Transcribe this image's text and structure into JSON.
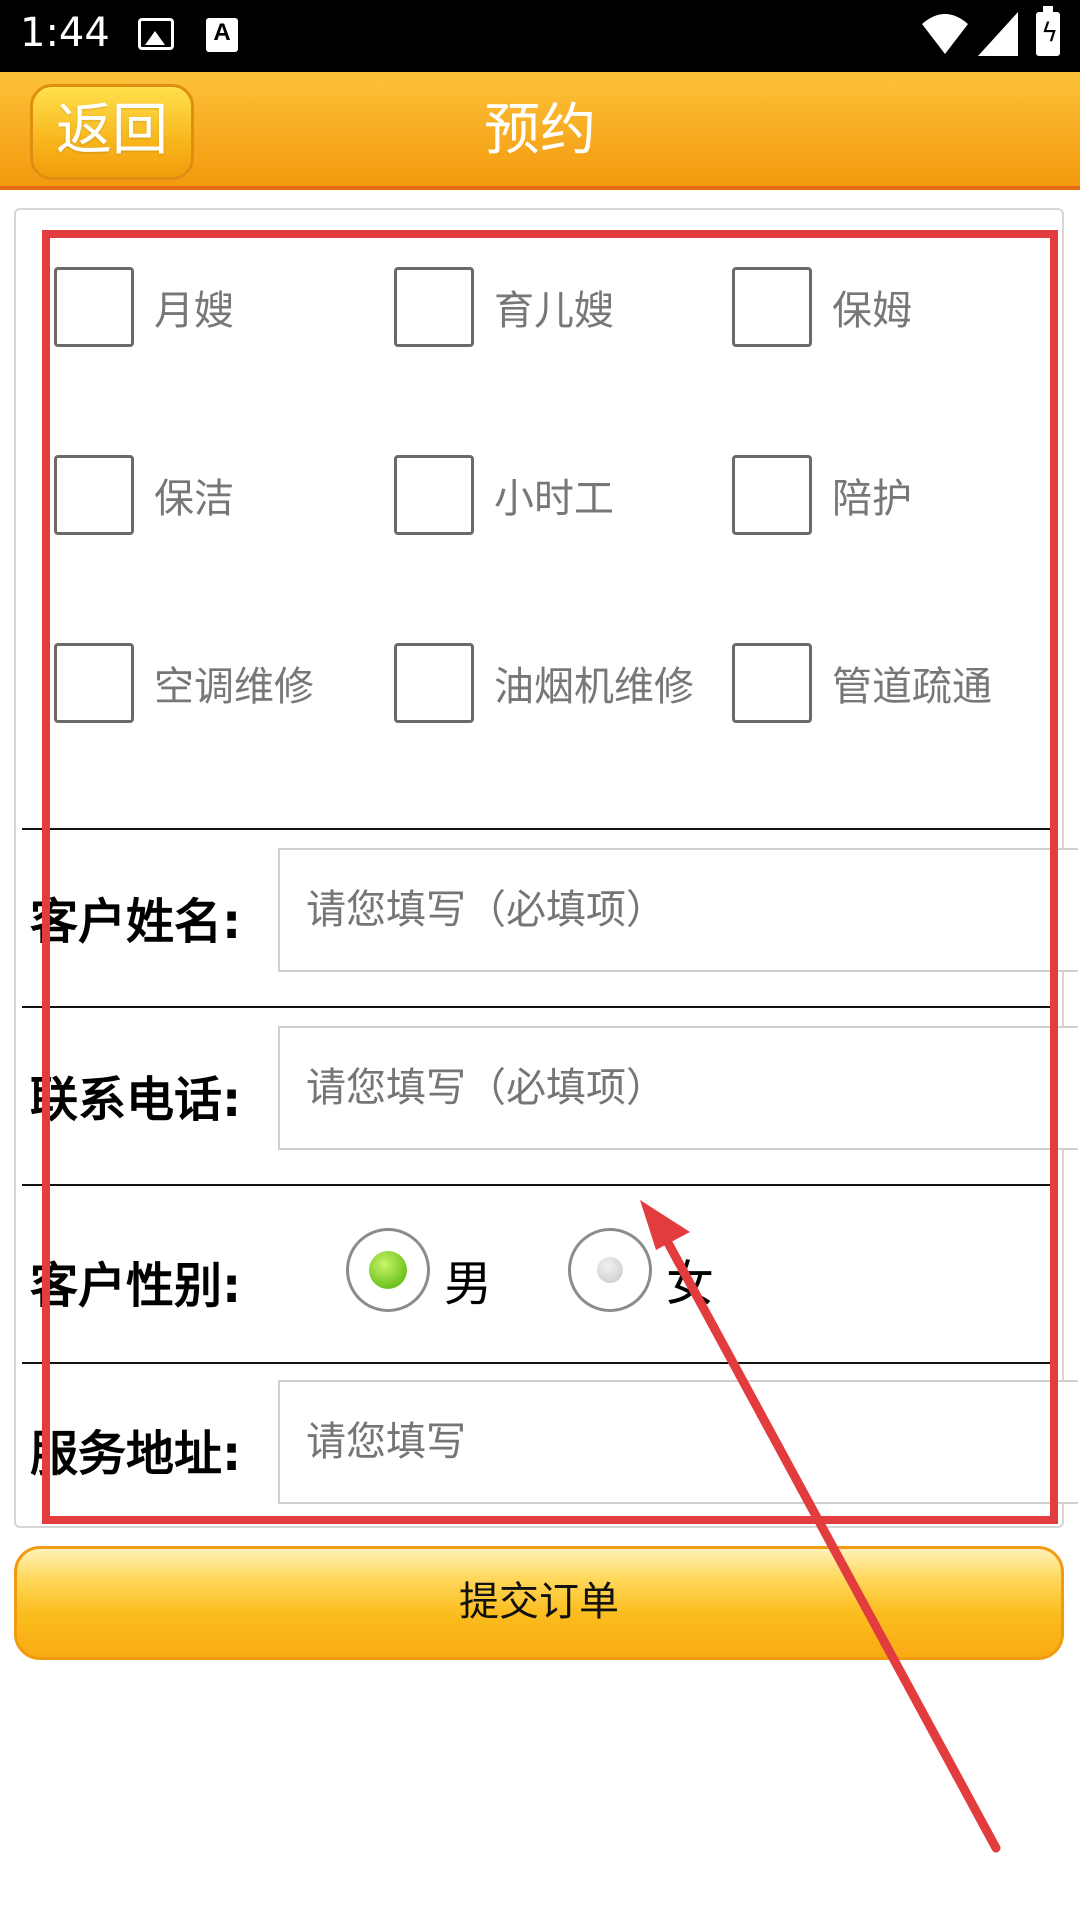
{
  "status_bar": {
    "time": "1:44",
    "icons": [
      "image-icon",
      "a11y-a-icon",
      "wifi-icon",
      "signal-icon",
      "battery-icon"
    ]
  },
  "header": {
    "back_label": "返回",
    "title": "预约"
  },
  "services": [
    {
      "label": "月嫂",
      "checked": false
    },
    {
      "label": "育儿嫂",
      "checked": false
    },
    {
      "label": "保姆",
      "checked": false
    },
    {
      "label": "保洁",
      "checked": false
    },
    {
      "label": "小时工",
      "checked": false
    },
    {
      "label": "陪护",
      "checked": false
    },
    {
      "label": "空调维修",
      "checked": false
    },
    {
      "label": "油烟机维修",
      "checked": false
    },
    {
      "label": "管道疏通",
      "checked": false
    }
  ],
  "form": {
    "name_label": "客户姓名:",
    "name_placeholder": "请您填写（必填项）",
    "phone_label": "联系电话:",
    "phone_placeholder": "请您填写（必填项）",
    "gender_label": "客户性别:",
    "gender_options": [
      {
        "label": "男",
        "selected": true
      },
      {
        "label": "女",
        "selected": false
      }
    ],
    "address_label": "服务地址:",
    "address_placeholder": "请您填写"
  },
  "submit_label": "提交订单",
  "colors": {
    "header_top": "#fdc23a",
    "header_bottom": "#f39a0e",
    "annotation_red": "#e23c3f",
    "radio_selected": "#6fc31e"
  }
}
